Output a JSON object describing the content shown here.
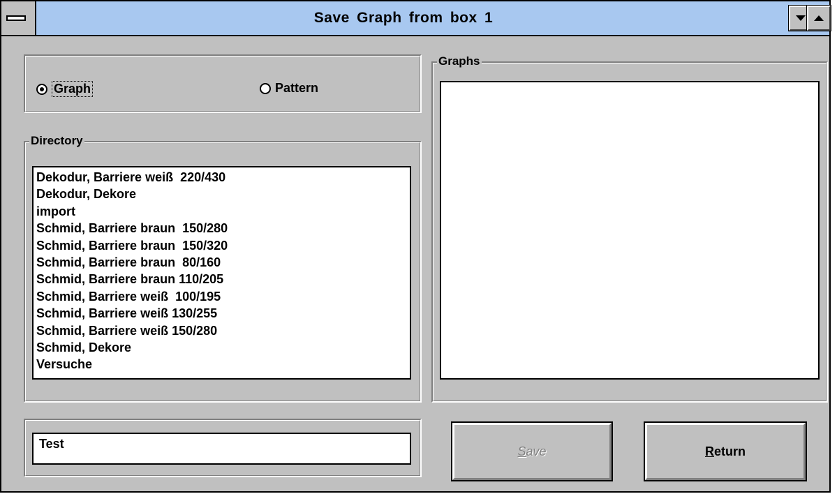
{
  "window": {
    "title": "Save  Graph  from box 1"
  },
  "mode": {
    "options": [
      {
        "label": "Graph",
        "checked": true
      },
      {
        "label": "Pattern",
        "checked": false
      }
    ]
  },
  "directory": {
    "label": "Directory",
    "items": [
      "Dekodur, Barriere weiß  220/430",
      "Dekodur, Dekore",
      "import",
      "Schmid, Barriere braun  150/280",
      "Schmid, Barriere braun  150/320",
      "Schmid, Barriere braun  80/160",
      "Schmid, Barriere braun 110/205",
      "Schmid, Barriere weiß  100/195",
      "Schmid, Barriere weiß 130/255",
      "Schmid, Barriere weiß 150/280",
      "Schmid, Dekore",
      "Versuche"
    ]
  },
  "graphs": {
    "label": "Graphs",
    "items": []
  },
  "filename": {
    "value": "Test"
  },
  "buttons": {
    "save_label": "Save",
    "save_enabled": false,
    "return_label": "Return",
    "return_enabled": true
  },
  "colors": {
    "title_bar": "#a8c8f0",
    "window_bg": "#c0c0c0",
    "disabled_text": "#808080"
  }
}
